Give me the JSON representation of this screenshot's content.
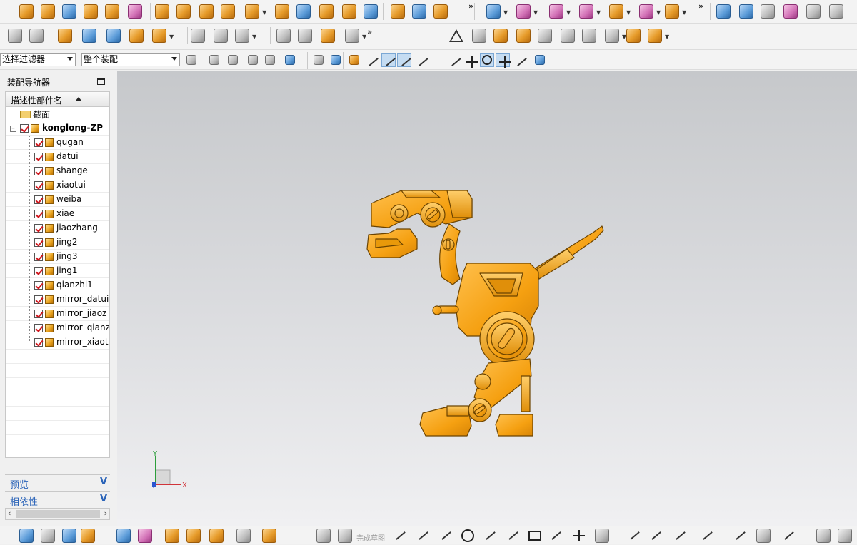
{
  "toolbar": {
    "filter_select": "选择过滤器",
    "scope_select": "整个装配"
  },
  "navigator": {
    "title": "装配导航器",
    "column_header": "描述性部件名",
    "section_node": "截面",
    "root": "konglong-ZP",
    "children": [
      "qugan",
      "datui",
      "shange",
      "xiaotui",
      "weiba",
      "xiae",
      "jiaozhang",
      "jing2",
      "jing3",
      "jing1",
      "qianzhi1",
      "mirror_datui",
      "mirror_jiaoz",
      "mirror_qianz",
      "mirror_xiaot"
    ],
    "preview_label": "预览",
    "dependency_label": "相依性"
  },
  "viewport": {
    "model_color": "#f5a623",
    "axis_y": "Y",
    "axis_x": "X"
  },
  "bottombar": {
    "finish_sketch": "完成草图"
  },
  "icons": [
    "box-icon",
    "hole-icon",
    "chamfer-icon",
    "mirror-icon",
    "sketch-line-icon",
    "arc-icon",
    "circle-icon",
    "rectangle-icon",
    "point-icon"
  ]
}
